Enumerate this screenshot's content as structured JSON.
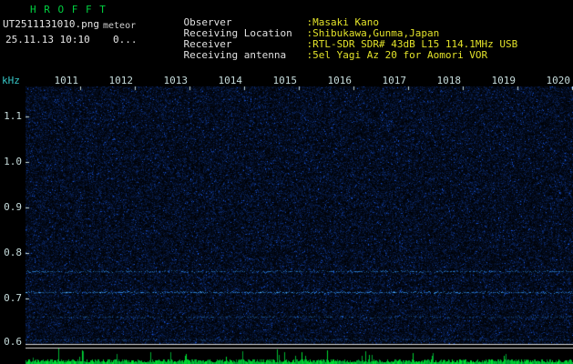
{
  "header": {
    "app_title": "H R O F F T",
    "filename": "UT2511131010.png",
    "station_id": "meteor",
    "datetime": "25.11.13 10:10",
    "echo_count": "0...",
    "info": [
      {
        "label": "Observer",
        "value": ":Masaki Kano"
      },
      {
        "label": "Receiving Location",
        "value": ":Shibukawa,Gunma,Japan"
      },
      {
        "label": "Receiver",
        "value": ":RTL-SDR SDR# 43dB L15 114.1MHz USB"
      },
      {
        "label": "Receiving antenna",
        "value": ":5el Yagi Az 20 for Aomori VOR"
      }
    ]
  },
  "chart_data": {
    "type": "heatmap",
    "title": "",
    "xlabel": "",
    "ylabel": "kHz",
    "x_ticks": [
      "1011",
      "1012",
      "1013",
      "1014",
      "1015",
      "1016",
      "1017",
      "1018",
      "1019",
      "1020"
    ],
    "y_ticks": [
      "1.1",
      "1.0",
      "0.9",
      "0.8",
      "0.7",
      "0.6"
    ],
    "y_range_khz": [
      0.6,
      1.17
    ],
    "grid": false,
    "legend": false,
    "background": "dark-blue broadband noise, no meteor echoes visible",
    "carrier_lines": [
      {
        "freq_khz": 0.76,
        "intensity": 0.8
      },
      {
        "freq_khz": 0.715,
        "intensity": 1.0
      },
      {
        "freq_khz": 0.66,
        "intensity": 0.45
      },
      {
        "freq_khz": 0.61,
        "intensity": 0.3
      }
    ],
    "signal_strip": "green noise-floor trace at bottom"
  },
  "colors": {
    "title_green": "#00d040",
    "text_white": "#e6e6e6",
    "value_yellow": "#e2e22a",
    "axis_cyan": "#36c8c8",
    "tick_label": "#c6dcdc",
    "noise_blue": "#2a50d0",
    "line_cyan": "#4fb0ff",
    "signal_green": "#00c84a",
    "separator_white": "#d8d8d8"
  }
}
